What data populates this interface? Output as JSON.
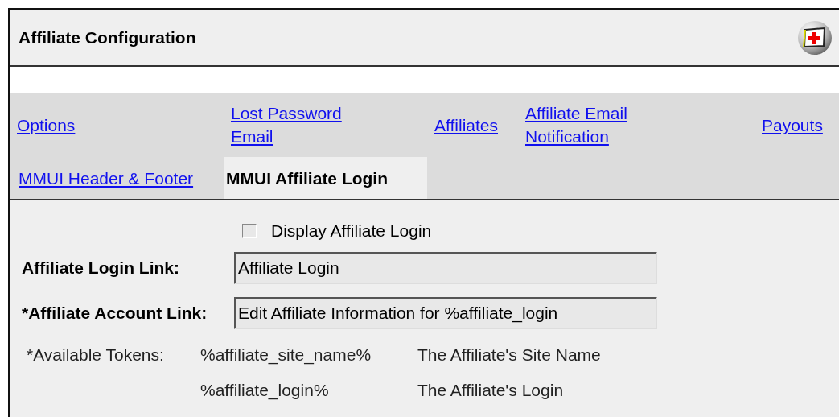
{
  "window": {
    "title": "Affiliate Configuration"
  },
  "tabs": [
    [
      {
        "label": "Options",
        "selected": false
      },
      {
        "label": "Lost Password Email",
        "selected": false
      },
      {
        "label": "Affiliates",
        "selected": false
      },
      {
        "label": "Affiliate Email Notification",
        "selected": false
      },
      {
        "label": "Payouts",
        "selected": false
      }
    ],
    [
      {
        "label": "MMUI Header & Footer",
        "selected": false
      },
      {
        "label": "MMUI Affiliate Login",
        "selected": true
      }
    ]
  ],
  "display_checkbox": {
    "label": "Display Affiliate Login",
    "checked": false
  },
  "fields": [
    {
      "label": "Affiliate Login Link:",
      "value": "Affiliate Login"
    },
    {
      "label": "*Affiliate Account Link:",
      "value": "Edit Affiliate Information for %affiliate_login"
    }
  ],
  "tokens": {
    "label": "*Available Tokens:",
    "items": [
      {
        "token": "%affiliate_site_name%",
        "description": "The Affiliate's Site Name"
      },
      {
        "token": "%affiliate_login%",
        "description": "The Affiliate's Login"
      }
    ]
  }
}
